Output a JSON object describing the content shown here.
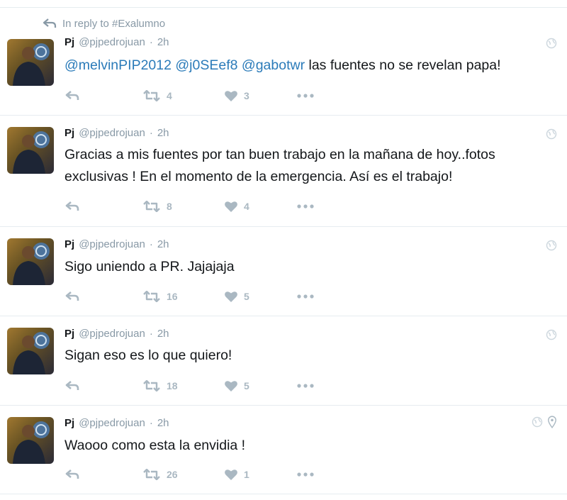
{
  "reply_context": {
    "label": "In reply to #Exalumno"
  },
  "colors": {
    "mention": "#2b7bb9",
    "meta": "#8899a6",
    "action": "#aab8c2",
    "divider": "#e6ecf0"
  },
  "tweets": [
    {
      "name": "Pj",
      "handle": "@pjpedrojuan",
      "dot": "·",
      "time": "2h",
      "mentions": [
        "@melvinPIP2012",
        "@j0SEef8",
        "@gabotwr"
      ],
      "text": "las fuentes no se revelan papa!",
      "retweets": "4",
      "likes": "3",
      "has_location": false
    },
    {
      "name": "Pj",
      "handle": "@pjpedrojuan",
      "dot": "·",
      "time": "2h",
      "line1": "Gracias a mis fuentes por tan buen trabajo en la mañana de hoy..fotos",
      "line2": "exclusivas ! En el momento de la emergencia. Así es el trabajo!",
      "retweets": "8",
      "likes": "4",
      "has_location": false
    },
    {
      "name": "Pj",
      "handle": "@pjpedrojuan",
      "dot": "·",
      "time": "2h",
      "text": "Sigo uniendo a PR. Jajajaja",
      "retweets": "16",
      "likes": "5",
      "has_location": false
    },
    {
      "name": "Pj",
      "handle": "@pjpedrojuan",
      "dot": "·",
      "time": "2h",
      "text": "Sigan eso es lo que quiero!",
      "retweets": "18",
      "likes": "5",
      "has_location": false
    },
    {
      "name": "Pj",
      "handle": "@pjpedrojuan",
      "dot": "·",
      "time": "2h",
      "text": "Waooo como esta la envidia !",
      "retweets": "26",
      "likes": "1",
      "has_location": true
    }
  ],
  "icons": {
    "reply": "reply-arrow-icon",
    "retweet": "retweet-icon",
    "like": "heart-icon",
    "more": "more-dots-icon",
    "globe": "globe-icon",
    "location": "location-pin-icon"
  }
}
